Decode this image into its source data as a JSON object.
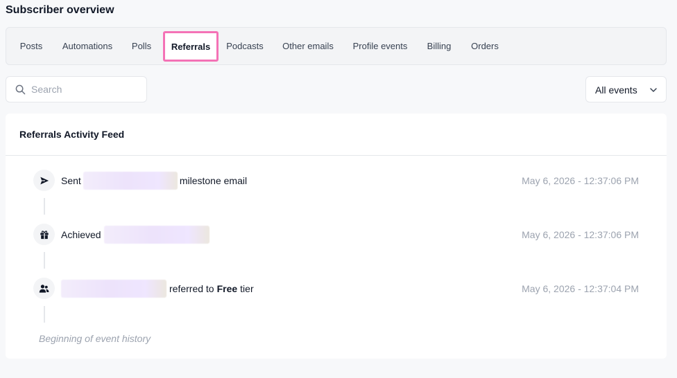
{
  "header": {
    "title": "Subscriber overview"
  },
  "tabs": [
    {
      "label": "Posts"
    },
    {
      "label": "Automations"
    },
    {
      "label": "Polls"
    },
    {
      "label": "Referrals"
    },
    {
      "label": "Podcasts"
    },
    {
      "label": "Other emails"
    },
    {
      "label": "Profile events"
    },
    {
      "label": "Billing"
    },
    {
      "label": "Orders"
    }
  ],
  "active_tab": "Referrals",
  "search": {
    "placeholder": "Search",
    "value": ""
  },
  "filter": {
    "selected": "All events"
  },
  "feed": {
    "title": "Referrals Activity Feed",
    "events": [
      {
        "icon": "send-icon",
        "prefix": "Sent",
        "suffix": "milestone email",
        "time": "May 6, 2026 - 12:37:06 PM"
      },
      {
        "icon": "gift-icon",
        "prefix": "Achieved",
        "suffix": "",
        "time": "May 6, 2026 - 12:37:06 PM"
      },
      {
        "icon": "users-icon",
        "prefix": "",
        "suffix_text": "referred to",
        "tier": "Free",
        "tier_suffix": "tier",
        "time": "May 6, 2026 - 12:37:04 PM"
      }
    ],
    "end_label": "Beginning of event history"
  },
  "colors": {
    "active_tab_border": "#f472b6",
    "muted_text": "#9ca3af",
    "redaction": "#ede3fb"
  }
}
